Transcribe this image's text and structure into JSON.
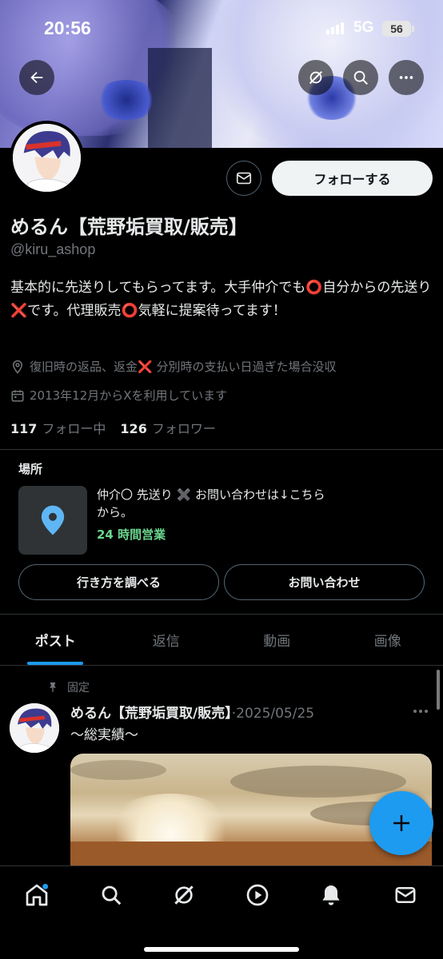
{
  "status_bar": {
    "time": "20:56",
    "network": "5G",
    "battery": "56"
  },
  "profile": {
    "display_name": "めるん【荒野垢買取/販売】",
    "handle": "@kiru_ashop",
    "bio": "基本的に先送りしてもらってます。大手仲介でも⭕自分からの先送り❌です。代理販売⭕気軽に提案待ってます！",
    "location": "復旧時の返品、返金❌ 分別時の支払い日過ぎた場合没収",
    "joined": "2013年12月からXを利用しています",
    "following_count": "117",
    "following_label": "フォロー中",
    "followers_count": "126",
    "followers_label": "フォロワー",
    "follow_button": "フォローする"
  },
  "location_module": {
    "title": "場所",
    "description": "仲介〇 先送り ✖️ お問い合わせは↓こちらから。",
    "hours": "24 時間営業",
    "directions_button": "行き方を調べる",
    "contact_button": "お問い合わせ"
  },
  "tabs": [
    {
      "label": "ポスト",
      "active": true
    },
    {
      "label": "返信",
      "active": false
    },
    {
      "label": "動画",
      "active": false
    },
    {
      "label": "画像",
      "active": false
    }
  ],
  "pinned_post": {
    "pinned_label": "固定",
    "author": "めるん【荒野垢買取/販売】",
    "date": "·2025/05/25",
    "text": "〜総実績〜"
  },
  "colors": {
    "accent": "#1d9bf0",
    "hours_green": "#6bd68e",
    "muted": "#71767b",
    "background": "#000000"
  },
  "icons": [
    "back-arrow-icon",
    "grok-icon",
    "search-icon",
    "more-icon",
    "mail-icon",
    "location-pin-icon",
    "calendar-icon",
    "map-pin-icon",
    "pin-icon",
    "plus-icon",
    "home-icon",
    "explore-icon",
    "grok-icon",
    "video-icon",
    "bell-icon",
    "messages-icon"
  ]
}
